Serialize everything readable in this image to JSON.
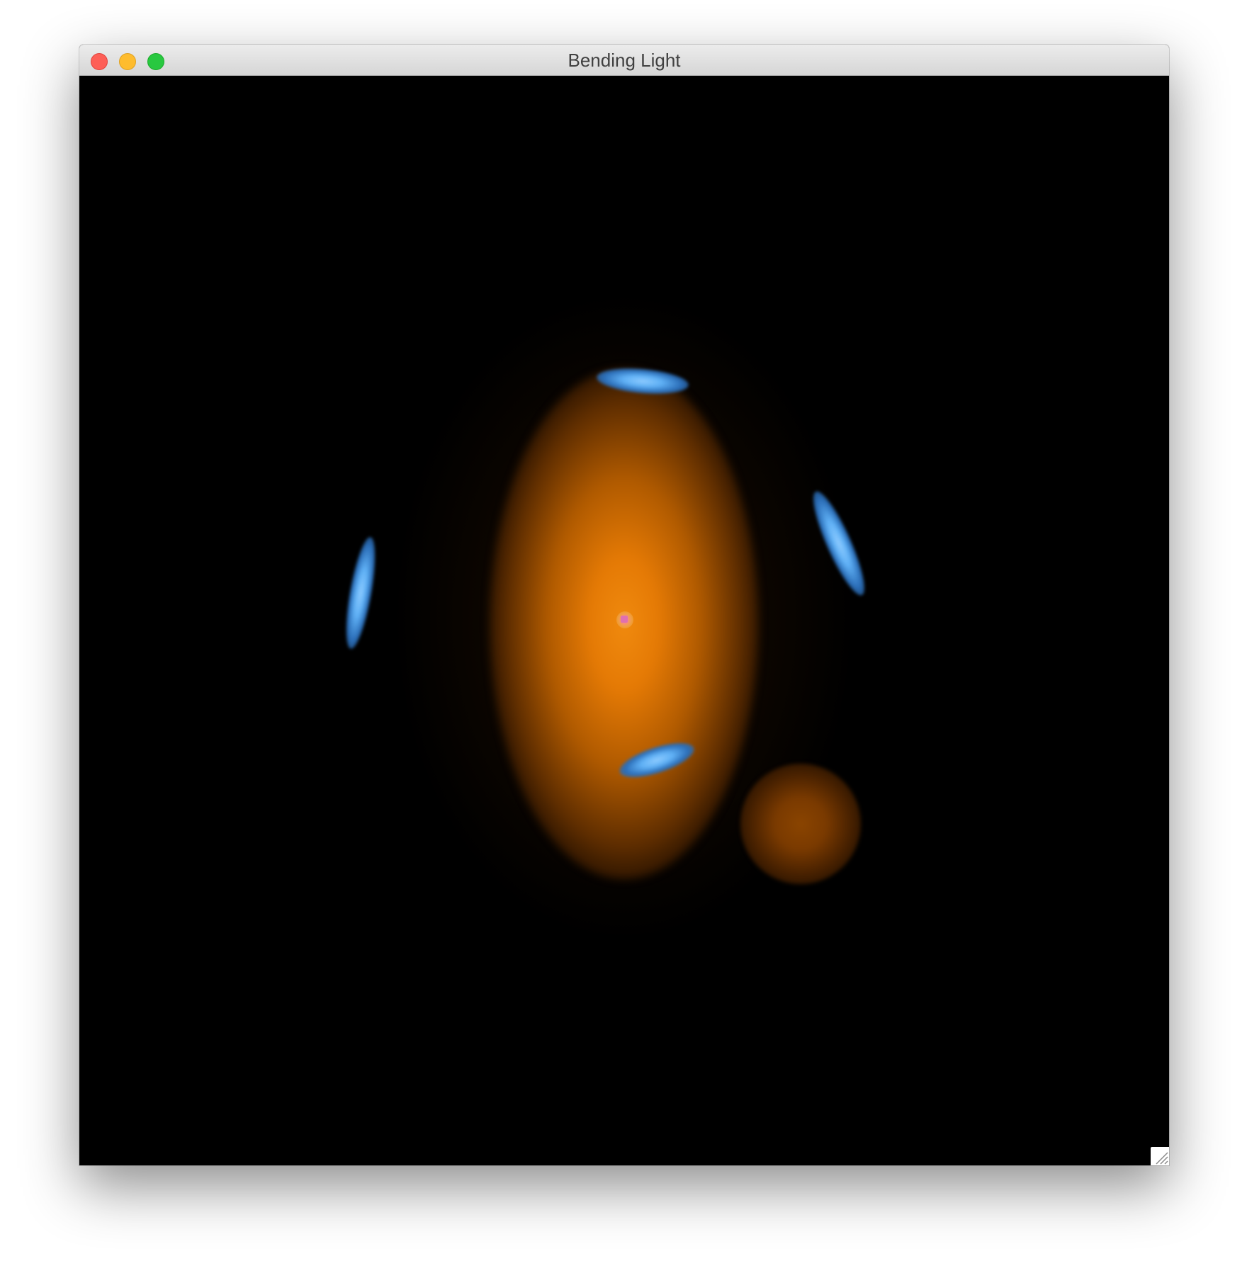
{
  "window": {
    "title": "Bending Light",
    "controls": {
      "close": "close-button",
      "minimize": "minimize-button",
      "maximize": "maximize-button"
    }
  },
  "scene": {
    "background_color": "#000000",
    "lens_galaxy_color": "#f08a0e",
    "source_galaxy_color": "#8a4400",
    "lensed_arc_color": "#6ab8ff",
    "core_color": "#e070b0",
    "arc_count": 4
  },
  "icons": {
    "resize": "resize-grip-icon"
  }
}
